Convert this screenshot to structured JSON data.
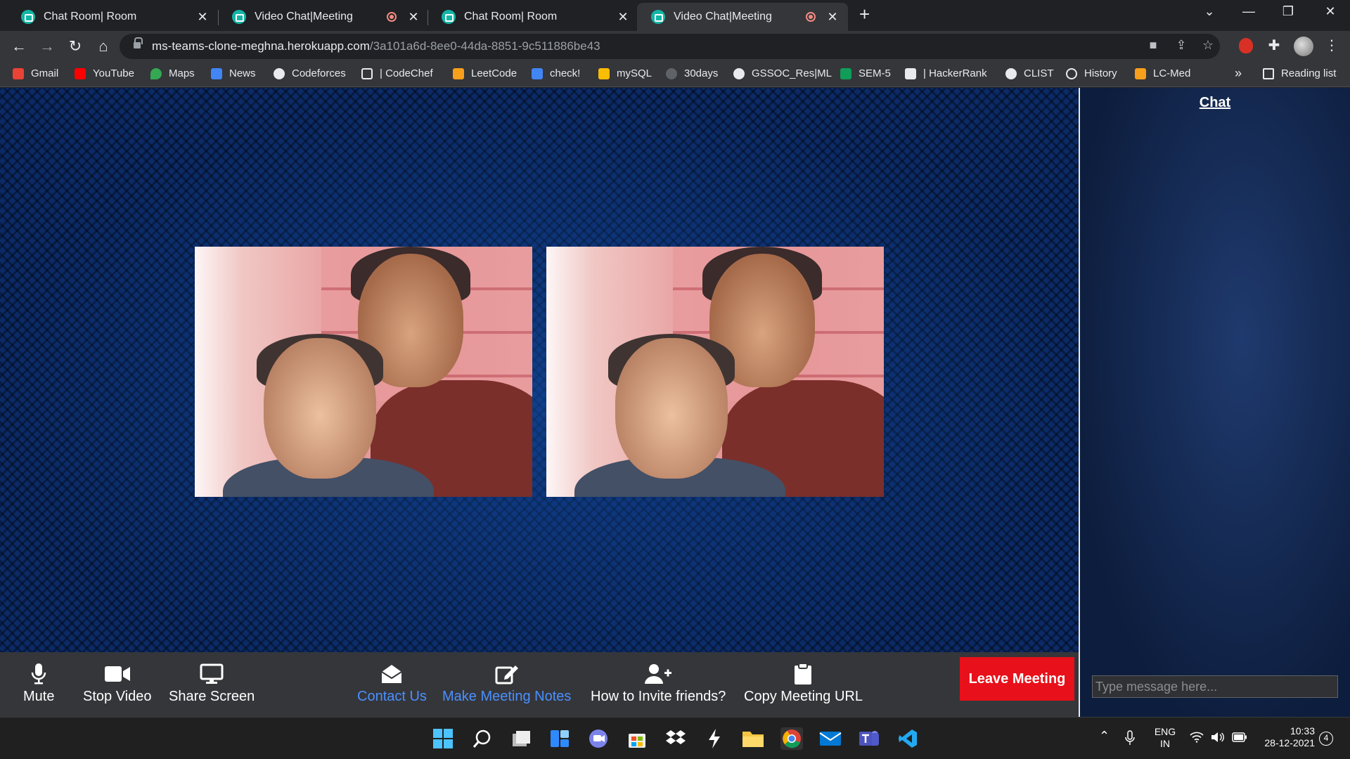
{
  "browser": {
    "tabs": [
      {
        "title": "Chat Room| Room",
        "recording": false,
        "active": false
      },
      {
        "title": "Video Chat|Meeting",
        "recording": true,
        "active": false
      },
      {
        "title": "Chat Room| Room",
        "recording": false,
        "active": false
      },
      {
        "title": "Video Chat|Meeting",
        "recording": true,
        "active": true
      }
    ],
    "url_host": "ms-teams-clone-meghna.herokuapp.com",
    "url_path": "/3a101a6d-8ee0-44da-8851-9c511886be43",
    "bookmarks": [
      {
        "label": "Gmail",
        "icon": "gmail-icon",
        "color": "#ea4335"
      },
      {
        "label": "YouTube",
        "icon": "youtube-icon",
        "color": "#ff0000"
      },
      {
        "label": "Maps",
        "icon": "maps-icon",
        "color": "#34a853"
      },
      {
        "label": "News",
        "icon": "news-icon",
        "color": "#4285f4"
      },
      {
        "label": "Codeforces",
        "icon": "globe-icon",
        "color": "#e8eaed"
      },
      {
        "label": "| CodeChef",
        "icon": "codechef-icon",
        "color": "#e8eaed"
      },
      {
        "label": "LeetCode",
        "icon": "leetcode-icon",
        "color": "#f89f1b"
      },
      {
        "label": "check!",
        "icon": "docs-icon",
        "color": "#4285f4"
      },
      {
        "label": "mySQL",
        "icon": "keep-icon",
        "color": "#fbbc04"
      },
      {
        "label": "30days",
        "icon": "30days-icon",
        "color": "#5f6368"
      },
      {
        "label": "GSSOC_Res|ML",
        "icon": "github-icon",
        "color": "#e8eaed"
      },
      {
        "label": "SEM-5",
        "icon": "sheets-plus-icon",
        "color": "#0f9d58"
      },
      {
        "label": "| HackerRank",
        "icon": "hackerrank-icon",
        "color": "#e8eaed"
      },
      {
        "label": "CLIST",
        "icon": "globe-icon",
        "color": "#e8eaed"
      },
      {
        "label": "History",
        "icon": "history-icon",
        "color": "#e8eaed"
      },
      {
        "label": "LC-Med",
        "icon": "leetcode-icon",
        "color": "#f89f1b"
      }
    ],
    "bookmarks_more": "»",
    "reading_list": "Reading list"
  },
  "meeting": {
    "controls": [
      {
        "label": "Mute",
        "icon": "microphone-icon",
        "highlighted": false
      },
      {
        "label": "Stop Video",
        "icon": "video-camera-icon",
        "highlighted": false
      },
      {
        "label": "Share Screen",
        "icon": "desktop-icon",
        "highlighted": false
      },
      {
        "label": "Contact Us",
        "icon": "envelope-open-icon",
        "highlighted": true
      },
      {
        "label": "Make Meeting Notes",
        "icon": "edit-icon",
        "highlighted": true
      },
      {
        "label": "How to Invite friends?",
        "icon": "user-plus-icon",
        "highlighted": false
      },
      {
        "label": "Copy Meeting URL",
        "icon": "clipboard-icon",
        "highlighted": false
      }
    ],
    "leave_label": "Leave Meeting",
    "accent_color": "#e8101a",
    "highlight_color": "#4a90ff"
  },
  "chat": {
    "title": "Chat",
    "input_placeholder": "Type message here..."
  },
  "taskbar": {
    "apps": [
      "windows-start-icon",
      "search-icon",
      "task-view-icon",
      "widgets-icon",
      "teams-chat-icon",
      "store-icon",
      "dropbox-icon",
      "lightning-icon",
      "file-explorer-icon",
      "chrome-icon",
      "mail-icon",
      "teams-icon",
      "vscode-icon"
    ],
    "language_line1": "ENG",
    "language_line2": "IN",
    "time": "10:33",
    "date": "28-12-2021",
    "notifications": "4"
  }
}
